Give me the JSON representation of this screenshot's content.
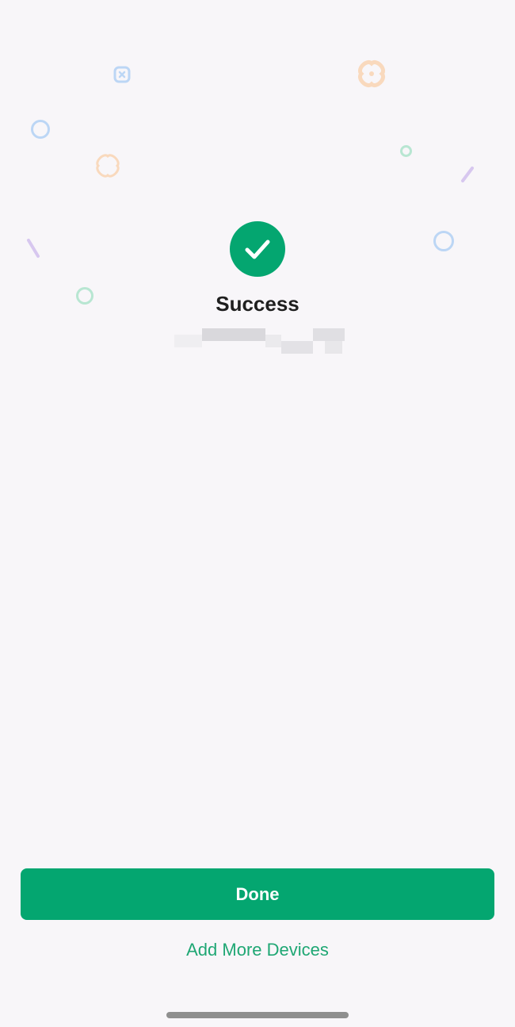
{
  "status": {
    "title": "Success",
    "icon": "checkmark-circle-icon",
    "device_name": "",
    "accent_color": "#04a670"
  },
  "actions": {
    "done_label": "Done",
    "add_more_label": "Add More Devices"
  },
  "decorations": {
    "icons": [
      "confetti-cross-icon",
      "confetti-ring-icon",
      "confetti-dash-icon"
    ],
    "colors": {
      "blue": "#bcd6f5",
      "orange": "#f9d9bd",
      "green": "#b8e6d2",
      "purple": "#d7c7ef"
    }
  }
}
